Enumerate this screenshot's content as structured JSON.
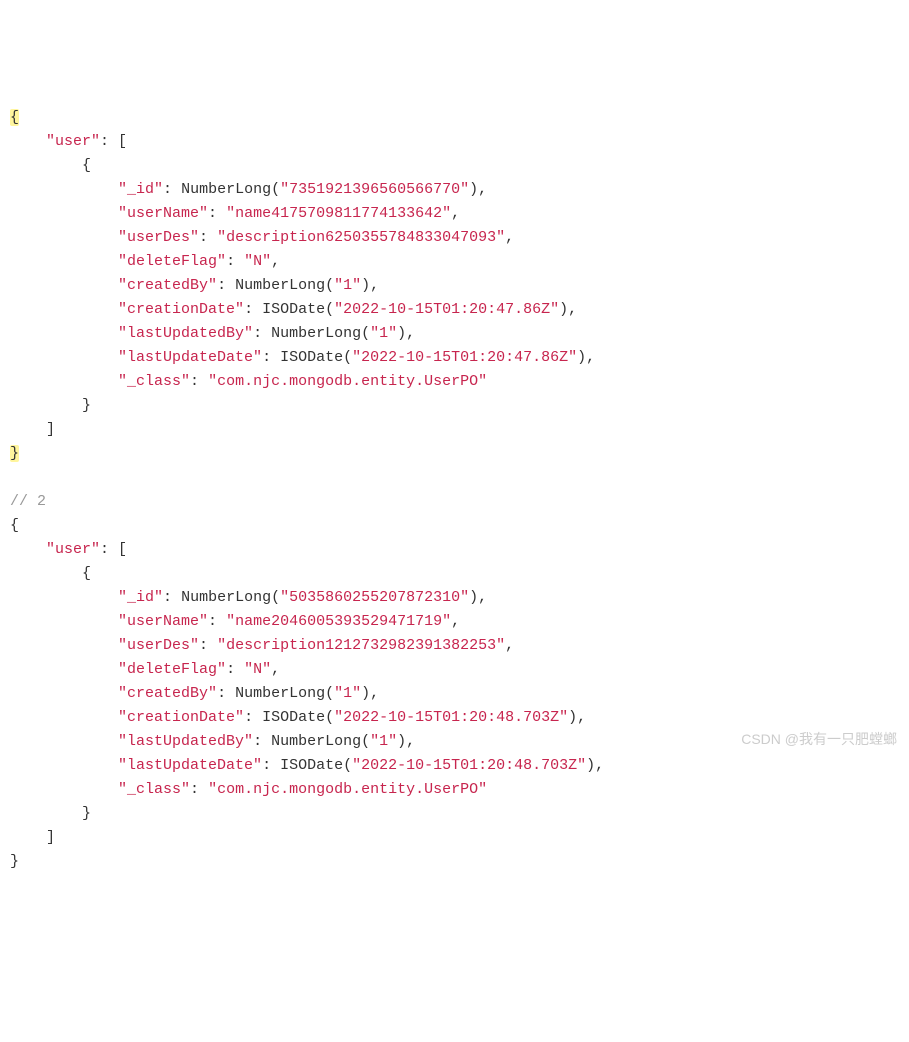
{
  "comment2": "// 2",
  "watermark": "CSDN @我有一只肥螳螂",
  "block1": {
    "userKey": "\"user\"",
    "fields": {
      "idKey": "\"_id\"",
      "idFn": "NumberLong(",
      "idVal": "\"7351921396560566770\"",
      "userNameKey": "\"userName\"",
      "userNameVal": "\"name4175709811774133642\"",
      "userDesKey": "\"userDes\"",
      "userDesVal": "\"description6250355784833047093\"",
      "deleteFlagKey": "\"deleteFlag\"",
      "deleteFlagVal": "\"N\"",
      "createdByKey": "\"createdBy\"",
      "createdByFn": "NumberLong(",
      "createdByVal": "\"1\"",
      "creationDateKey": "\"creationDate\"",
      "creationDateFn": "ISODate(",
      "creationDateVal": "\"2022-10-15T01:20:47.86Z\"",
      "lastUpdatedByKey": "\"lastUpdatedBy\"",
      "lastUpdatedByFn": "NumberLong(",
      "lastUpdatedByVal": "\"1\"",
      "lastUpdateDateKey": "\"lastUpdateDate\"",
      "lastUpdateDateFn": "ISODate(",
      "lastUpdateDateVal": "\"2022-10-15T01:20:47.86Z\"",
      "classKey": "\"_class\"",
      "classVal": "\"com.njc.mongodb.entity.UserPO\""
    }
  },
  "block2": {
    "userKey": "\"user\"",
    "fields": {
      "idKey": "\"_id\"",
      "idFn": "NumberLong(",
      "idVal": "\"5035860255207872310\"",
      "userNameKey": "\"userName\"",
      "userNameVal": "\"name2046005393529471719\"",
      "userDesKey": "\"userDes\"",
      "userDesVal": "\"description1212732982391382253\"",
      "deleteFlagKey": "\"deleteFlag\"",
      "deleteFlagVal": "\"N\"",
      "createdByKey": "\"createdBy\"",
      "createdByFn": "NumberLong(",
      "createdByVal": "\"1\"",
      "creationDateKey": "\"creationDate\"",
      "creationDateFn": "ISODate(",
      "creationDateVal": "\"2022-10-15T01:20:48.703Z\"",
      "lastUpdatedByKey": "\"lastUpdatedBy\"",
      "lastUpdatedByFn": "NumberLong(",
      "lastUpdatedByVal": "\"1\"",
      "lastUpdateDateKey": "\"lastUpdateDate\"",
      "lastUpdateDateFn": "ISODate(",
      "lastUpdateDateVal": "\"2022-10-15T01:20:48.703Z\"",
      "classKey": "\"_class\"",
      "classVal": "\"com.njc.mongodb.entity.UserPO\""
    }
  }
}
